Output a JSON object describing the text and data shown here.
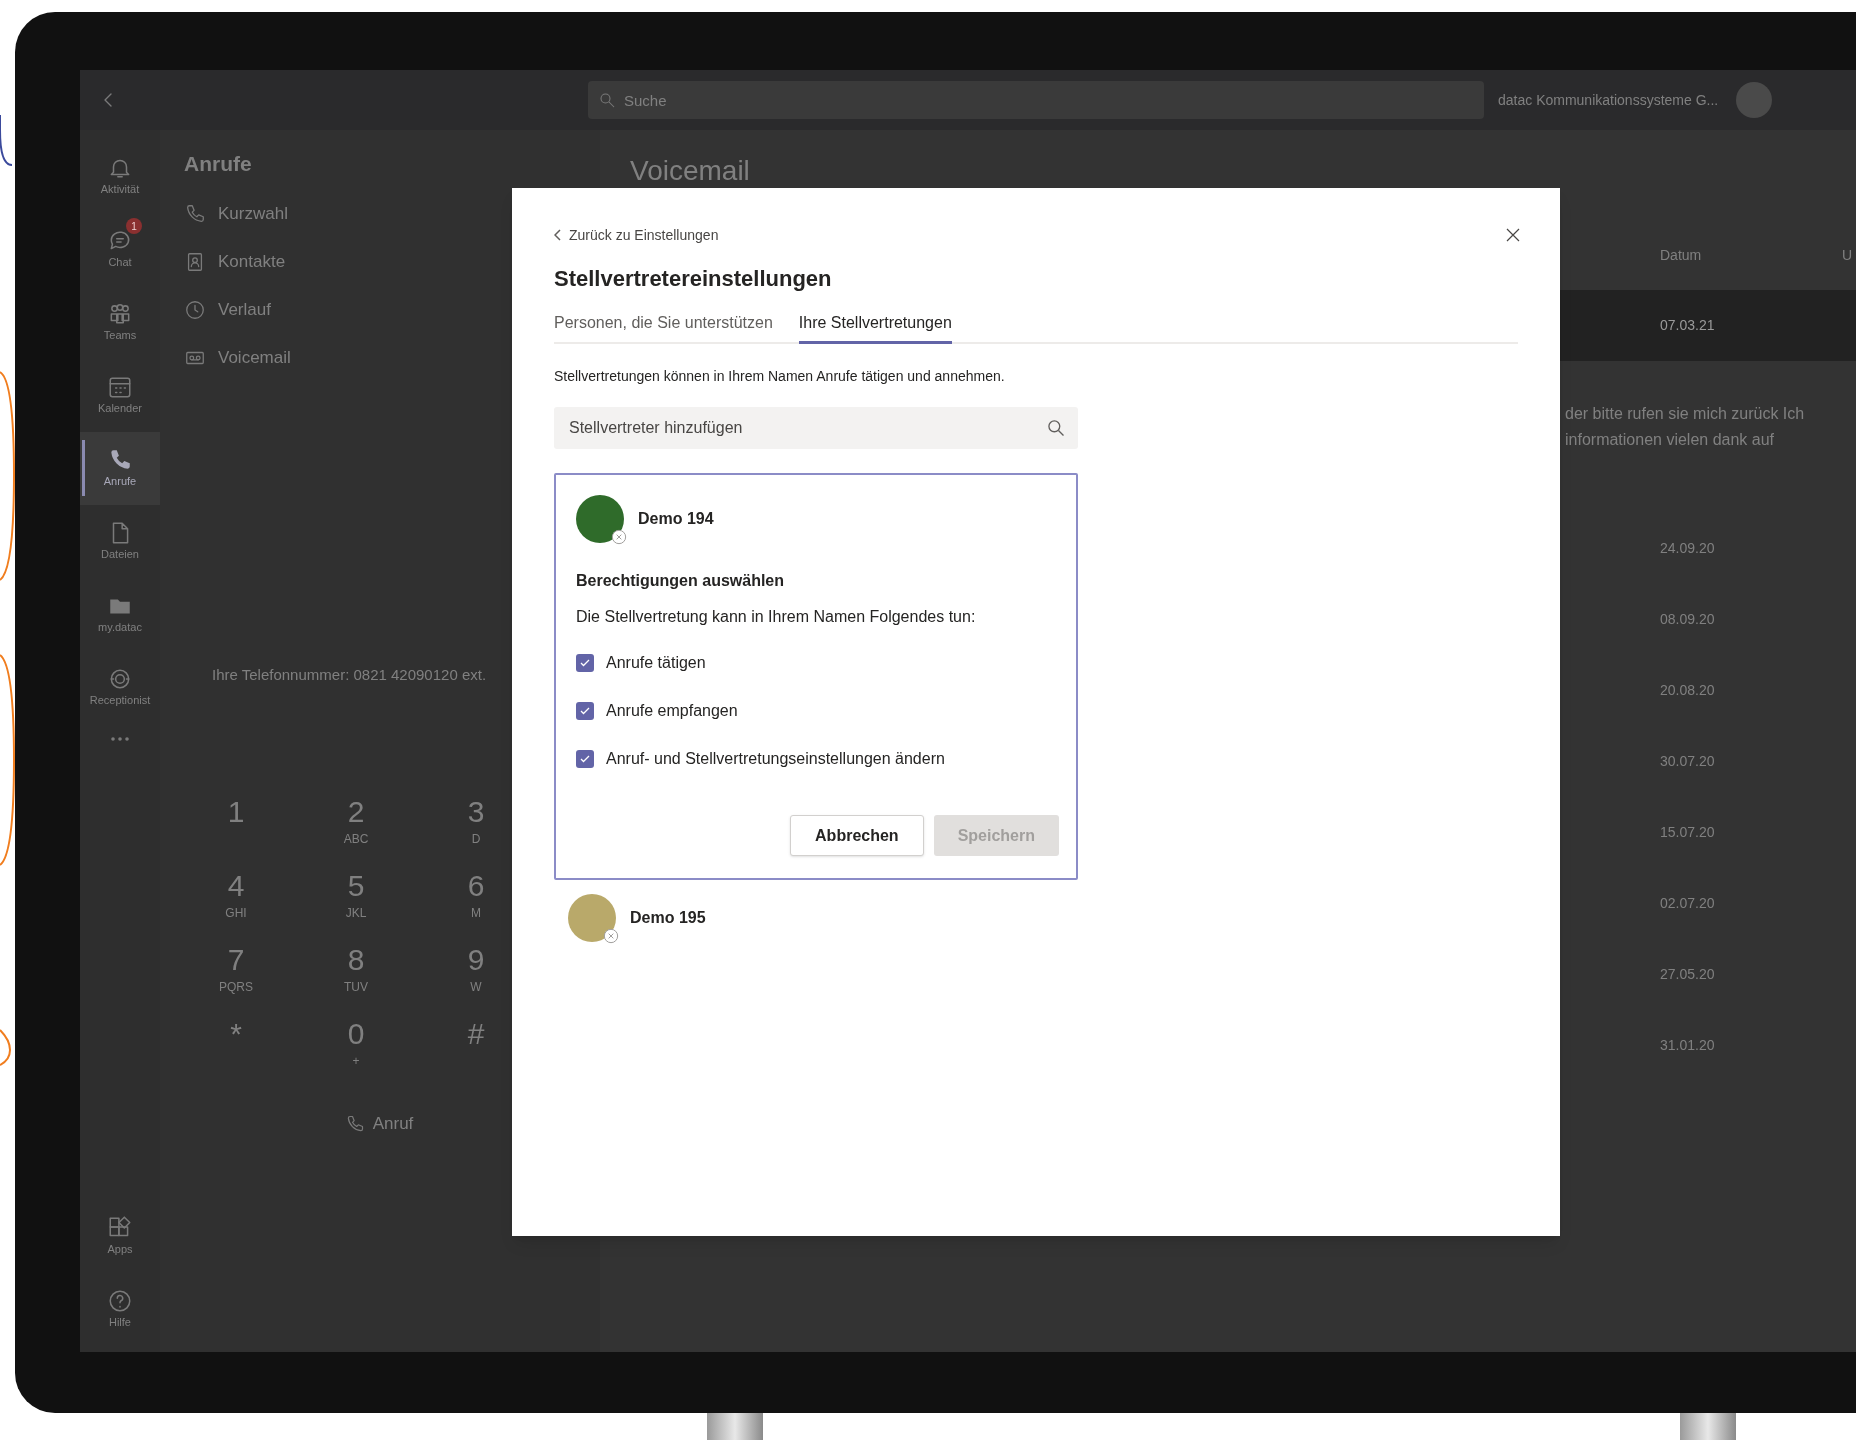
{
  "titlebar": {
    "search": {
      "placeholder": "Suche"
    },
    "org_name": "datac Kommunikationssysteme G..."
  },
  "rail": {
    "items": [
      {
        "label": "Aktivität",
        "selected": false
      },
      {
        "label": "Chat",
        "selected": false,
        "badge": "1"
      },
      {
        "label": "Teams",
        "selected": false
      },
      {
        "label": "Kalender",
        "selected": false
      },
      {
        "label": "Anrufe",
        "selected": true
      },
      {
        "label": "Dateien",
        "selected": false
      },
      {
        "label": "my.datac",
        "selected": false
      },
      {
        "label": "Receptionist",
        "selected": false
      }
    ],
    "bottom_items": [
      {
        "label": "Apps"
      },
      {
        "label": "Hilfe"
      }
    ]
  },
  "calls_pane": {
    "title": "Anrufe",
    "nav": [
      {
        "label": "Kurzwahl"
      },
      {
        "label": "Kontakte"
      },
      {
        "label": "Verlauf"
      },
      {
        "label": "Voicemail"
      }
    ],
    "phone_number": "Ihre Telefonnummer: 0821 42090120 ext.",
    "dialpad": [
      {
        "digit": "1"
      },
      {
        "digit": "2",
        "letters": "ABC"
      },
      {
        "digit": "3",
        "letters": "D"
      },
      {
        "digit": "4",
        "letters": "GHI"
      },
      {
        "digit": "5",
        "letters": "JKL"
      },
      {
        "digit": "6",
        "letters": "M"
      },
      {
        "digit": "7",
        "letters": "PQRS"
      },
      {
        "digit": "8",
        "letters": "TUV"
      },
      {
        "digit": "9",
        "letters": "W"
      },
      {
        "digit": "*"
      },
      {
        "digit": "0",
        "letters": "+"
      },
      {
        "digit": "#"
      }
    ],
    "call_button": "Anruf"
  },
  "voicemail": {
    "title": "Voicemail",
    "columns": [
      "Datum",
      "U"
    ],
    "rows": [
      {
        "date": "07.03.21",
        "selected": true,
        "transcript": [
          "der bitte rufen sie mich zurück Ich",
          "informationen vielen dank auf"
        ]
      },
      {
        "date": "24.09.20",
        "selected": false
      },
      {
        "date": "08.09.20",
        "selected": false
      },
      {
        "date": "20.08.20",
        "selected": false
      },
      {
        "date": "30.07.20",
        "selected": false
      },
      {
        "date": "15.07.20",
        "selected": false
      },
      {
        "date": "02.07.20",
        "selected": false
      },
      {
        "date": "27.05.20",
        "selected": false
      },
      {
        "date": "31.01.20",
        "selected": false
      }
    ]
  },
  "dialog": {
    "back_link": "Zurück zu Einstellungen",
    "title": "Stellvertretereinstellungen",
    "tabs": [
      {
        "label": "Personen, die Sie unterstützen",
        "selected": false
      },
      {
        "label": "Ihre Stellvertretungen",
        "selected": true
      }
    ],
    "description": "Stellvertretungen können in Ihrem Namen Anrufe tätigen und annehmen.",
    "search": {
      "placeholder": "Stellvertreter hinzufügen"
    },
    "delegates": [
      {
        "name": "Demo 194",
        "expanded": true,
        "permissions_title": "Berechtigungen auswählen",
        "permissions_text": "Die Stellvertretung kann in Ihrem Namen Folgendes tun:",
        "permissions": [
          {
            "label": "Anrufe tätigen",
            "checked": true
          },
          {
            "label": "Anrufe empfangen",
            "checked": true
          },
          {
            "label": "Anruf- und Stellvertretungseinstellungen ändern",
            "checked": true
          }
        ],
        "buttons": [
          {
            "label": "Abbrechen",
            "disabled": false
          },
          {
            "label": "Speichern",
            "disabled": true
          }
        ]
      },
      {
        "name": "Demo 195",
        "expanded": false
      }
    ]
  }
}
